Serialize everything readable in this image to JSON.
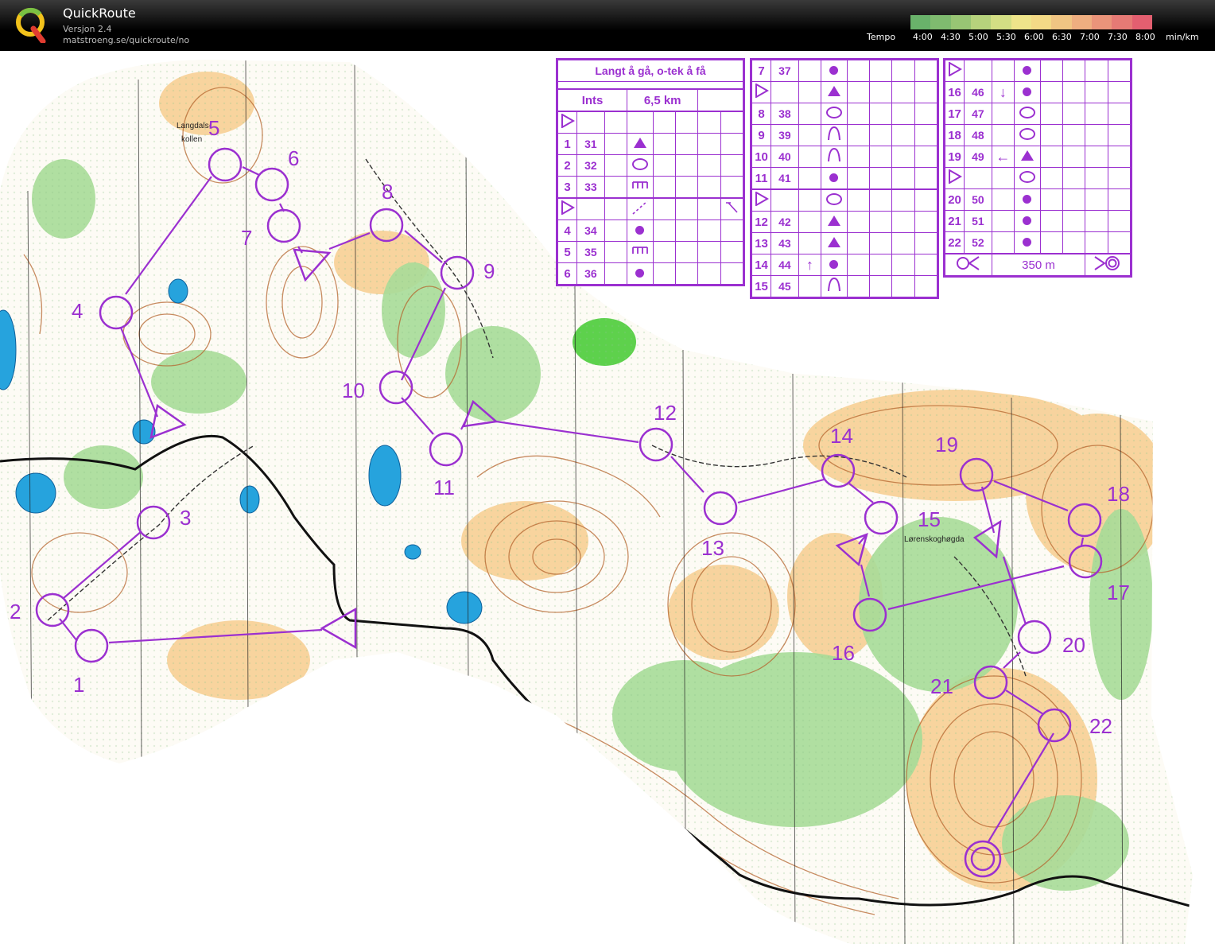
{
  "app": {
    "title": "QuickRoute",
    "version": "Versjon 2.4",
    "url": "matstroeng.se/quickroute/no",
    "logo_letter": "Q"
  },
  "tempo_legend": {
    "label": "Tempo",
    "ticks": [
      "4:00",
      "4:30",
      "5:00",
      "5:30",
      "6:00",
      "6:30",
      "7:00",
      "7:30",
      "8:00"
    ],
    "unit": "min/km",
    "colors": [
      "#69b26a",
      "#7fbb6f",
      "#98c574",
      "#b6d27c",
      "#d3de84",
      "#eee48a",
      "#f3d986",
      "#f0c583",
      "#eeae80",
      "#ea947a",
      "#e67a75",
      "#e35f70"
    ]
  },
  "colors": {
    "course": "#9b30d0",
    "open_land": "#f6c27e",
    "forest_green": "#99d48b",
    "water": "#2aa7df",
    "contour": "#a0522d",
    "road": "#111111"
  },
  "course": {
    "controls": [
      {
        "label": "1"
      },
      {
        "label": "2"
      },
      {
        "label": "3"
      },
      {
        "label": "4"
      },
      {
        "label": "5"
      },
      {
        "label": "6"
      },
      {
        "label": "7"
      },
      {
        "label": "8"
      },
      {
        "label": "9"
      },
      {
        "label": "10"
      },
      {
        "label": "11"
      },
      {
        "label": "12"
      },
      {
        "label": "13"
      },
      {
        "label": "14"
      },
      {
        "label": "15"
      },
      {
        "label": "16"
      },
      {
        "label": "17"
      },
      {
        "label": "18"
      },
      {
        "label": "19"
      },
      {
        "label": "20"
      },
      {
        "label": "21"
      },
      {
        "label": "22"
      }
    ]
  },
  "place_names": {
    "hill": "Langdals-\nkollen",
    "hill_line1": "Langdals-",
    "hill_line2": "kollen",
    "ridge": "Lørenskoghøgda"
  },
  "descriptions": {
    "title": "Langt å gå, o-tek å få",
    "class": "Ints",
    "length": "6,5 km",
    "finish_distance": "350 m",
    "rows_a": [
      {
        "n": "1",
        "code": "31",
        "sym": "tri"
      },
      {
        "n": "2",
        "code": "32",
        "sym": "oval"
      },
      {
        "n": "3",
        "code": "33",
        "sym": "comb"
      },
      {
        "n": "",
        "code": "",
        "sym": "start"
      },
      {
        "n": "4",
        "code": "34",
        "sym": "dot"
      },
      {
        "n": "5",
        "code": "35",
        "sym": "comb"
      },
      {
        "n": "6",
        "code": "36",
        "sym": "dot"
      }
    ],
    "rows_b": [
      {
        "n": "7",
        "code": "37",
        "dir": "",
        "sym": "dot"
      },
      {
        "n": "",
        "code": "",
        "dir": "",
        "sym": "tri"
      },
      {
        "n": "8",
        "code": "38",
        "dir": "",
        "sym": "oval"
      },
      {
        "n": "9",
        "code": "39",
        "dir": "",
        "sym": "knoll"
      },
      {
        "n": "10",
        "code": "40",
        "dir": "",
        "sym": "knoll"
      },
      {
        "n": "11",
        "code": "41",
        "dir": "",
        "sym": "dot"
      },
      {
        "n": "",
        "code": "",
        "dir": "",
        "sym": "oval"
      },
      {
        "n": "12",
        "code": "42",
        "dir": "",
        "sym": "tri"
      },
      {
        "n": "13",
        "code": "43",
        "dir": "",
        "sym": "tri"
      },
      {
        "n": "14",
        "code": "44",
        "dir": "↑",
        "sym": "dot"
      },
      {
        "n": "15",
        "code": "45",
        "dir": "",
        "sym": "knoll"
      }
    ],
    "rows_c": [
      {
        "n": "",
        "code": "",
        "dir": "",
        "sym": "dot"
      },
      {
        "n": "16",
        "code": "46",
        "dir": "↓",
        "sym": "dot"
      },
      {
        "n": "17",
        "code": "47",
        "dir": "",
        "sym": "oval"
      },
      {
        "n": "18",
        "code": "48",
        "dir": "",
        "sym": "oval"
      },
      {
        "n": "19",
        "code": "49",
        "dir": "←",
        "sym": "tri"
      },
      {
        "n": "",
        "code": "",
        "dir": "",
        "sym": "oval"
      },
      {
        "n": "20",
        "code": "50",
        "dir": "",
        "sym": "dot"
      },
      {
        "n": "21",
        "code": "51",
        "dir": "",
        "sym": "dot"
      },
      {
        "n": "22",
        "code": "52",
        "dir": "",
        "sym": "dot"
      }
    ]
  }
}
